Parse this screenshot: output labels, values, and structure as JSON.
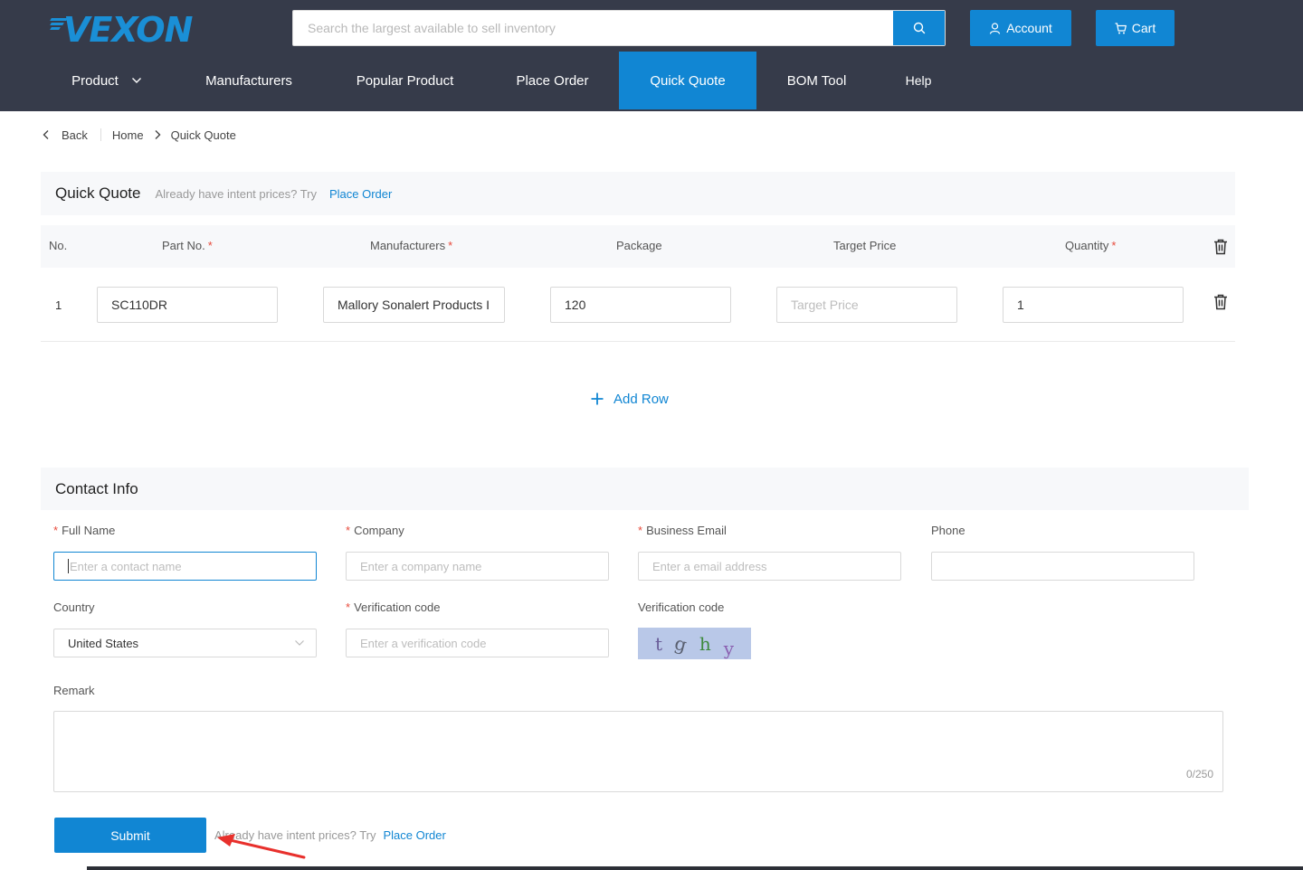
{
  "brand": {
    "logo": "VEXON"
  },
  "search": {
    "placeholder": "Search the largest available to sell inventory"
  },
  "header": {
    "account_label": "Account",
    "cart_label": "Cart"
  },
  "nav": {
    "items": [
      {
        "label": "Product"
      },
      {
        "label": "Manufacturers"
      },
      {
        "label": "Popular Product"
      },
      {
        "label": "Place Order"
      },
      {
        "label": "Quick Quote"
      },
      {
        "label": "BOM Tool"
      },
      {
        "label": "Help"
      }
    ],
    "active": "Quick Quote"
  },
  "breadcrumb": {
    "back": "Back",
    "home": "Home",
    "current": "Quick Quote"
  },
  "quote": {
    "title": "Quick Quote",
    "hint": "Already have intent prices? Try",
    "link": "Place Order",
    "columns": {
      "no": "No.",
      "part": "Part No.",
      "mfr": "Manufacturers",
      "package": "Package",
      "target": "Target Price",
      "qty": "Quantity",
      "required_mark": "*"
    },
    "rows": [
      {
        "no": "1",
        "part": "SC110DR",
        "mfr": "Mallory Sonalert Products I",
        "package": "120",
        "target_placeholder": "Target Price",
        "qty": "1"
      }
    ],
    "add_row": "Add Row"
  },
  "contact": {
    "title": "Contact Info",
    "full_name": {
      "label": "Full Name",
      "placeholder": "Enter a contact name"
    },
    "company": {
      "label": "Company",
      "placeholder": "Enter a company name"
    },
    "email": {
      "label": "Business Email",
      "placeholder": "Enter a email address"
    },
    "phone": {
      "label": "Phone"
    },
    "country": {
      "label": "Country",
      "value": "United States"
    },
    "verify": {
      "label": "Verification code",
      "placeholder": "Enter a verification code"
    },
    "captcha": {
      "label": "Verification code",
      "chars": [
        "t",
        "g",
        "h",
        "y"
      ]
    },
    "remark": {
      "label": "Remark",
      "counter": "0/250"
    },
    "required_mark": "*"
  },
  "footer": {
    "submit": "Submit",
    "hint": "Already have intent prices? Try",
    "link": "Place Order"
  },
  "colors": {
    "primary": "#1186d3",
    "header_bg": "#363b4a",
    "annotation_arrow": "#e8302c"
  }
}
